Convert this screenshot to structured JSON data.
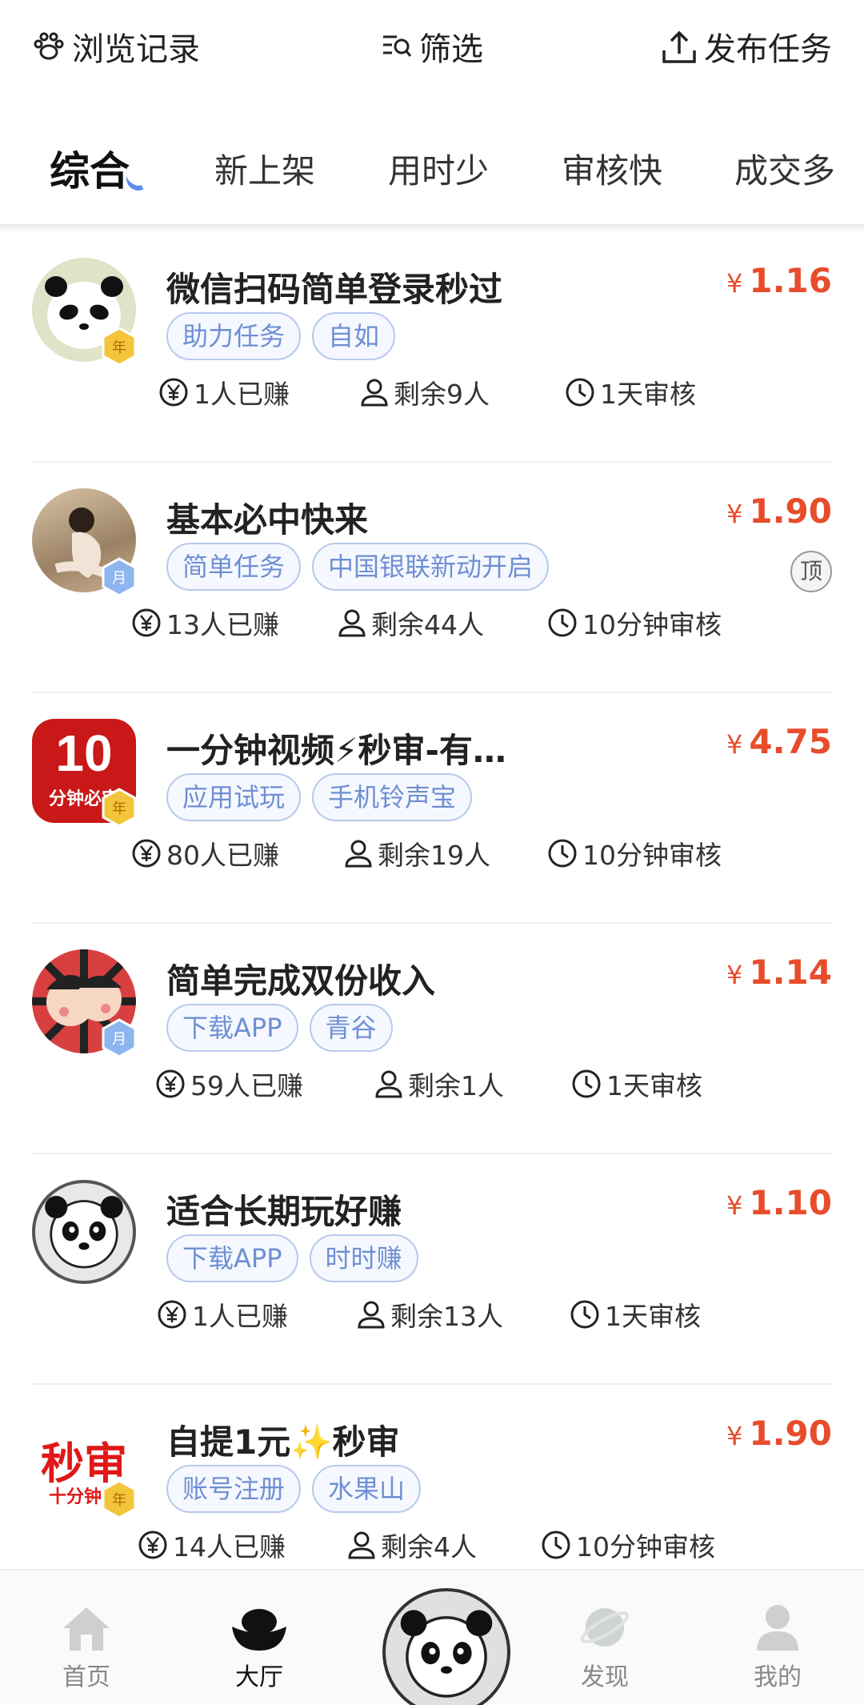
{
  "header": {
    "browse_label": "浏览记录",
    "filter_label": "筛选",
    "publish_label": "发布任务"
  },
  "tabs": [
    {
      "label": "综合",
      "active": true
    },
    {
      "label": "新上架"
    },
    {
      "label": "用时少"
    },
    {
      "label": "审核快"
    },
    {
      "label": "成交多"
    }
  ],
  "tasks": [
    {
      "title": "微信扫码简单登录秒过",
      "price": "1.16",
      "currency": "¥",
      "tags": [
        "助力任务",
        "自如"
      ],
      "earned": "1人已赚",
      "remaining": "剩余9人",
      "review": "1天审核",
      "pinned": false
    },
    {
      "title": "基本必中快来",
      "price": "1.90",
      "currency": "¥",
      "tags": [
        "简单任务",
        "中国银联新动开启"
      ],
      "earned": "13人已赚",
      "remaining": "剩余44人",
      "review": "10分钟审核",
      "pinned": true,
      "pinned_label": "顶"
    },
    {
      "title": "一分钟视频⚡秒审-有…",
      "price": "4.75",
      "currency": "¥",
      "tags": [
        "应用试玩",
        "手机铃声宝"
      ],
      "earned": "80人已赚",
      "remaining": "剩余19人",
      "review": "10分钟审核",
      "pinned": false,
      "avatar_text_big": "10",
      "avatar_text_small": "分钟必审"
    },
    {
      "title": "简单完成双份收入",
      "price": "1.14",
      "currency": "¥",
      "tags": [
        "下载APP",
        "青谷"
      ],
      "earned": "59人已赚",
      "remaining": "剩余1人",
      "review": "1天审核",
      "pinned": false
    },
    {
      "title": "适合长期玩好赚",
      "price": "1.10",
      "currency": "¥",
      "tags": [
        "下载APP",
        "时时赚"
      ],
      "earned": "1人已赚",
      "remaining": "剩余13人",
      "review": "1天审核",
      "pinned": false
    },
    {
      "title": "自提1元✨秒审",
      "price": "1.90",
      "currency": "¥",
      "tags": [
        "账号注册",
        "水果山"
      ],
      "earned": "14人已赚",
      "remaining": "剩余4人",
      "review": "10分钟审核",
      "pinned": false,
      "avatar_text_big": "秒审",
      "avatar_text_small": "十分钟审"
    }
  ],
  "nav": [
    {
      "label": "首页",
      "active": false
    },
    {
      "label": "大厅",
      "active": true
    },
    {
      "label": "发现",
      "active": false
    },
    {
      "label": "我的",
      "active": false
    }
  ],
  "colors": {
    "price": "#e74c2b",
    "tag_text": "#6f8fd3",
    "tab_accent": "#5b8def"
  }
}
